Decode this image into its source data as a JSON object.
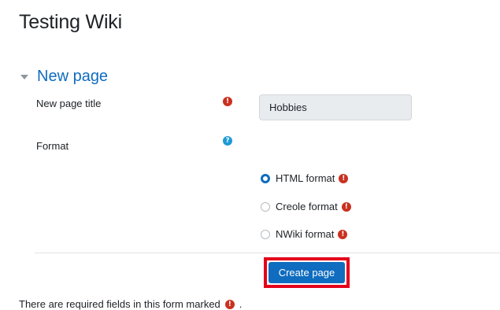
{
  "page": {
    "title": "Testing Wiki"
  },
  "section": {
    "title": "New page",
    "expanded": true
  },
  "form": {
    "title_field": {
      "label": "New page title",
      "value": "Hobbies",
      "required": true
    },
    "format_field": {
      "label": "Format",
      "has_help": true,
      "options": [
        {
          "label": "HTML format",
          "checked": true,
          "required": true
        },
        {
          "label": "Creole format",
          "checked": false,
          "required": true
        },
        {
          "label": "NWiki format",
          "checked": false,
          "required": true
        }
      ]
    },
    "submit_label": "Create page"
  },
  "footer": {
    "required_note_prefix": "There are required fields in this form marked",
    "required_note_suffix": "."
  },
  "colors": {
    "primary": "#0f6cbf",
    "required": "#ca3120",
    "help": "#1f9ad6",
    "highlight": "#e5001b"
  },
  "icons": {
    "required": "exclamation-circle-icon",
    "help": "question-circle-icon",
    "collapse": "caret-down-icon"
  }
}
